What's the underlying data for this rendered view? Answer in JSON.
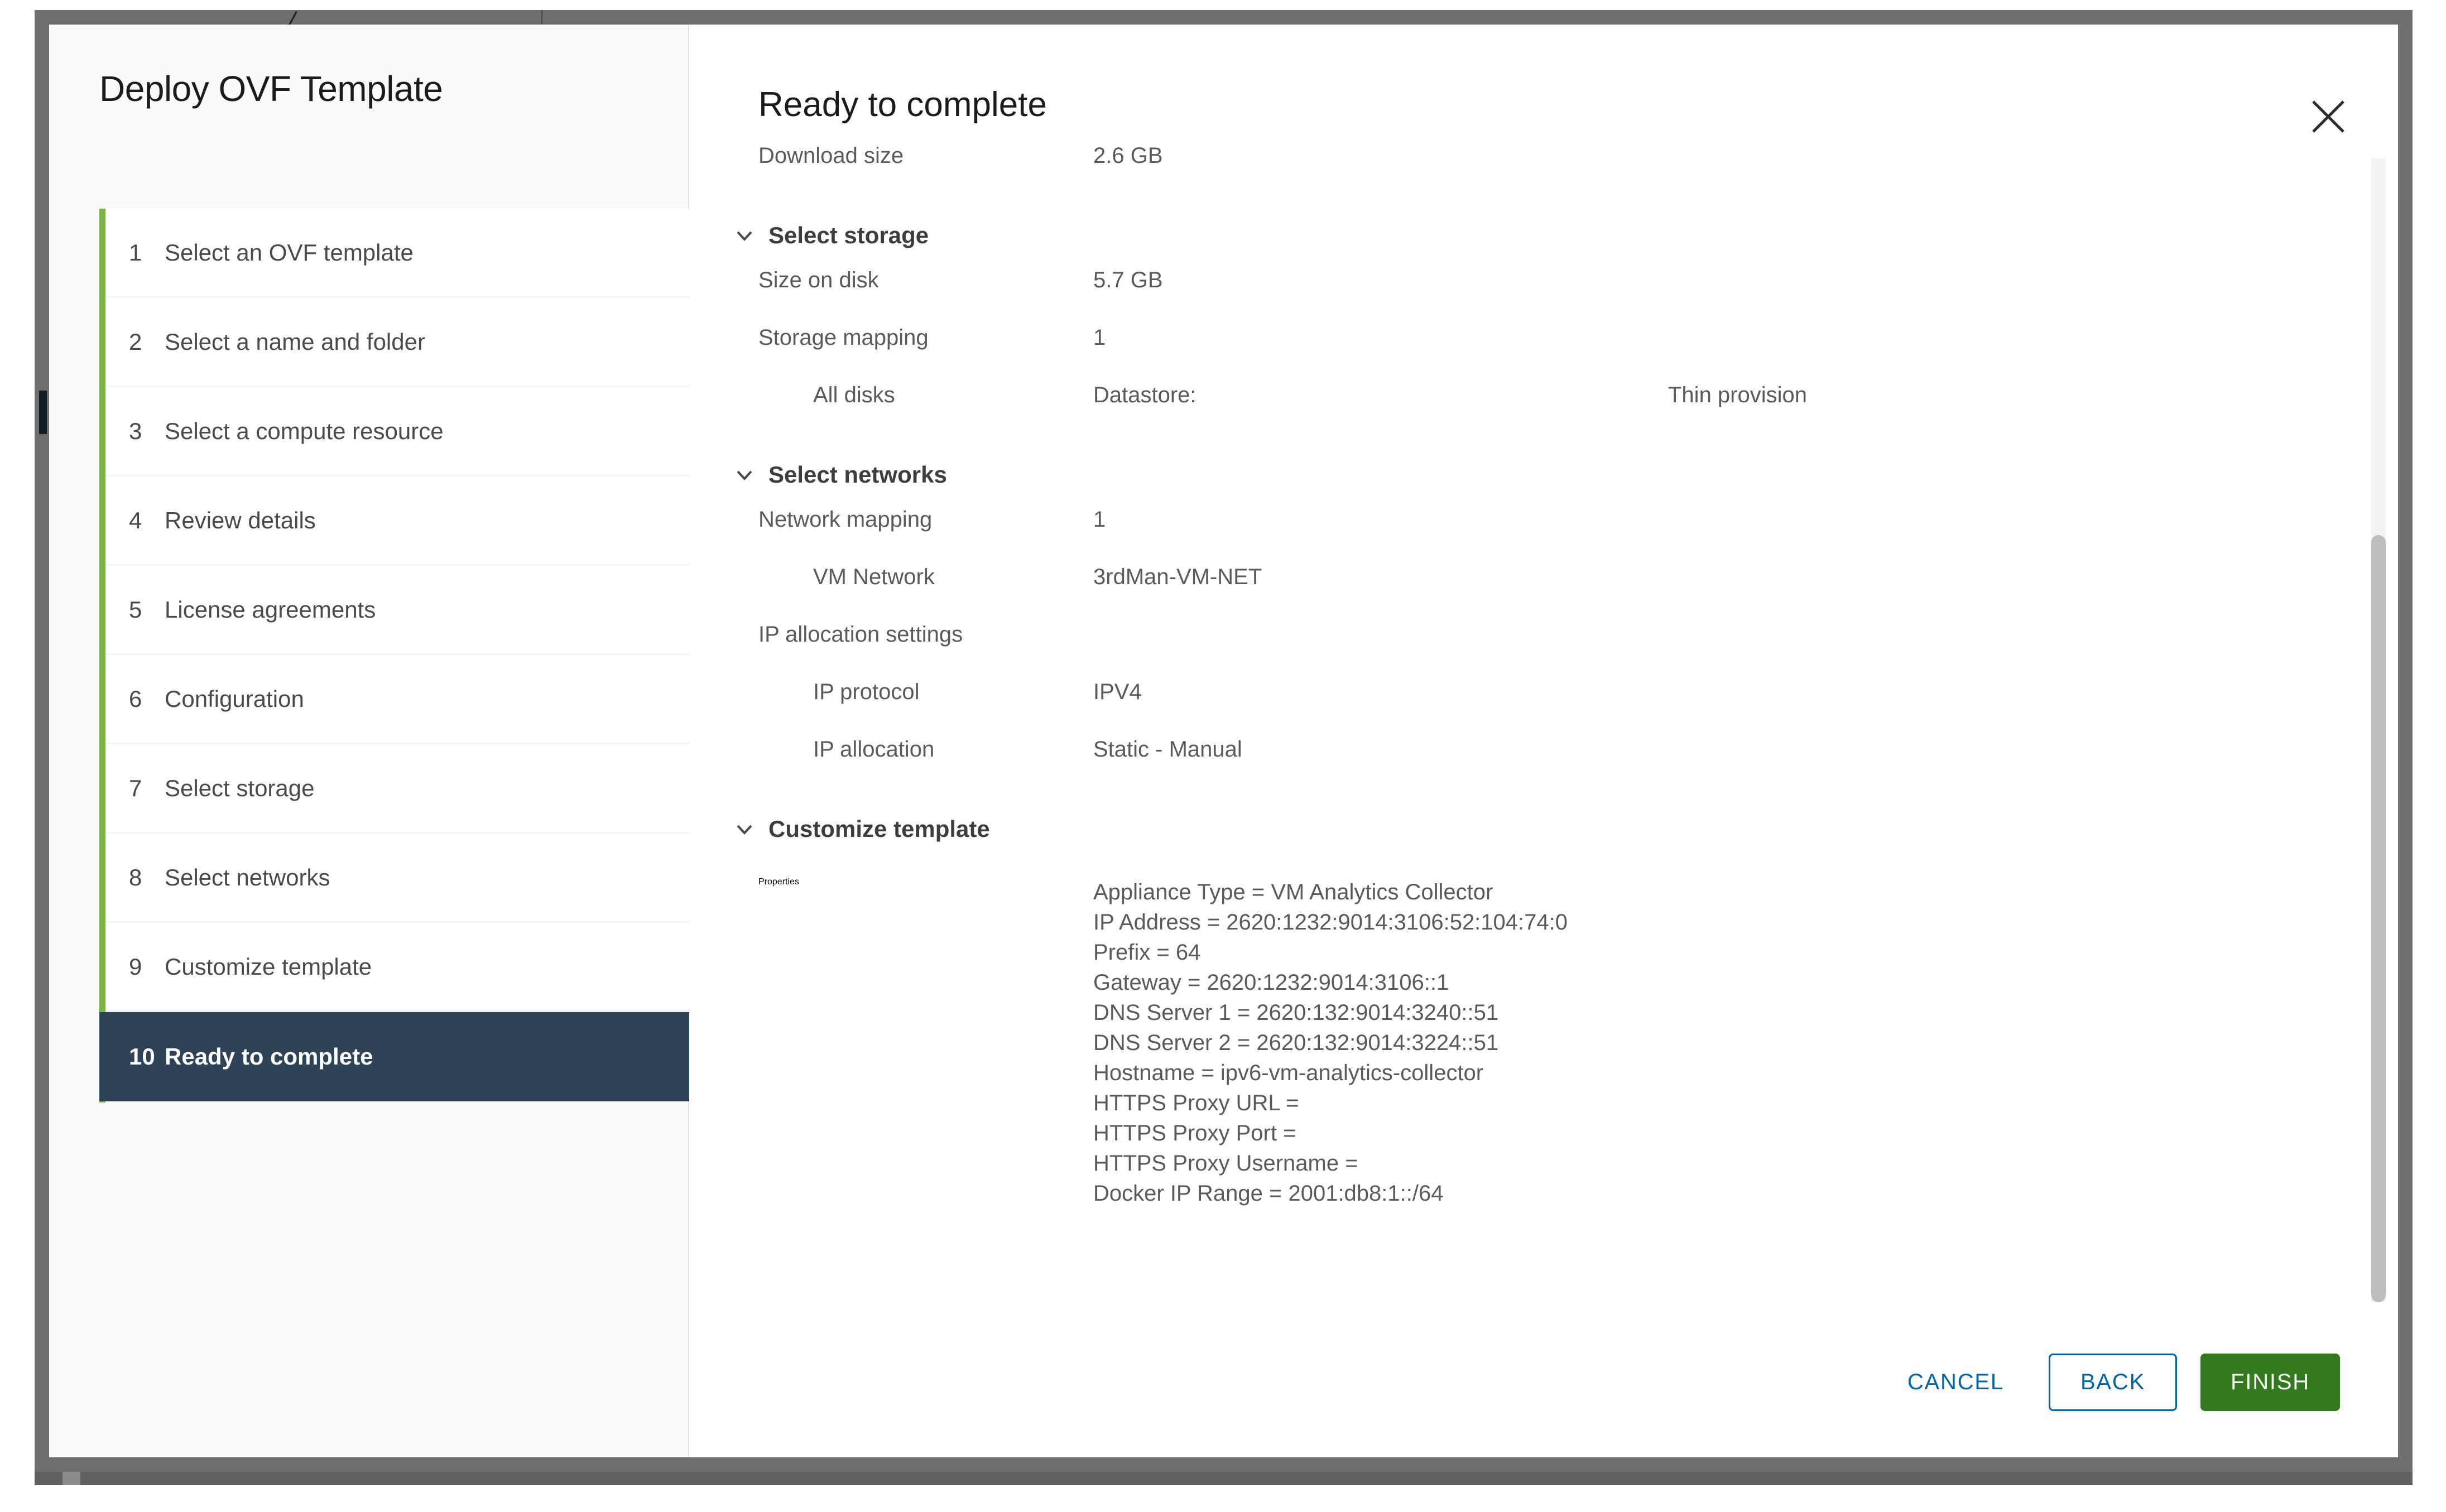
{
  "window": {
    "frame_color": "#6e6e6e"
  },
  "wizard": {
    "title": "Deploy OVF Template",
    "accent_progress_color": "#7cb342",
    "active_step_color": "#2f4356",
    "steps": [
      {
        "num": "1",
        "label": "Select an OVF template"
      },
      {
        "num": "2",
        "label": "Select a name and folder"
      },
      {
        "num": "3",
        "label": "Select a compute resource"
      },
      {
        "num": "4",
        "label": "Review details"
      },
      {
        "num": "5",
        "label": "License agreements"
      },
      {
        "num": "6",
        "label": "Configuration"
      },
      {
        "num": "7",
        "label": "Select storage"
      },
      {
        "num": "8",
        "label": "Select networks"
      },
      {
        "num": "9",
        "label": "Customize template"
      },
      {
        "num": "10",
        "label": "Ready to complete"
      }
    ],
    "active_step_index": 9
  },
  "content": {
    "heading": "Ready to complete",
    "close_icon": "close-icon",
    "chevron_icon": "chevron-down-icon",
    "download": {
      "label": "Download size",
      "value": "2.6 GB"
    },
    "select_storage": {
      "title": "Select storage",
      "size_on_disk": {
        "label": "Size on disk",
        "value": "5.7 GB"
      },
      "storage_mapping": {
        "label": "Storage mapping",
        "value": "1"
      },
      "all_disks": {
        "label": "All disks",
        "datastore": "Datastore:",
        "provision": "Thin provision"
      }
    },
    "select_networks": {
      "title": "Select networks",
      "network_mapping": {
        "label": "Network mapping",
        "value": "1"
      },
      "vm_network": {
        "label": "VM Network",
        "value": "3rdMan-VM-NET"
      },
      "ip_allocation_settings_label": "IP allocation settings",
      "ip_protocol": {
        "label": "IP protocol",
        "value": "IPV4"
      },
      "ip_allocation": {
        "label": "IP allocation",
        "value": "Static - Manual"
      }
    },
    "customize_template": {
      "title": "Customize template",
      "properties_label": "Properties",
      "properties_text": "Appliance Type = VM Analytics Collector\nIP Address = 2620:1232:9014:3106:52:104:74:0\nPrefix = 64\nGateway = 2620:1232:9014:3106::1\nDNS Server 1 = 2620:132:9014:3240::51\nDNS Server 2 = 2620:132:9014:3224::51\nHostname = ipv6-vm-analytics-collector\nHTTPS Proxy URL =\nHTTPS Proxy Port =\nHTTPS Proxy Username =\nDocker IP Range = 2001:db8:1::/64"
    }
  },
  "footer": {
    "cancel_label": "CANCEL",
    "back_label": "BACK",
    "finish_label": "FINISH",
    "link_color": "#0065ab",
    "finish_color": "#337a1f"
  }
}
